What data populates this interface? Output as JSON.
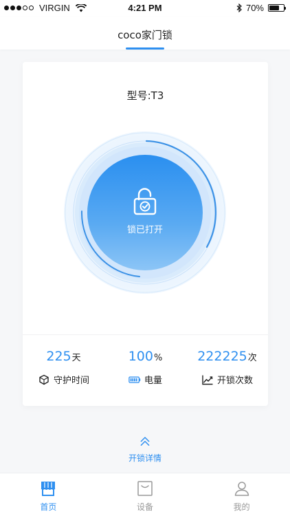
{
  "status_bar": {
    "carrier": "VIRGIN",
    "time": "4:21 PM",
    "battery": "70%",
    "battery_level": 0.7
  },
  "header": {
    "title": "coco家门锁"
  },
  "device": {
    "model": "型号:T3",
    "lock_status": "锁已打开",
    "lock_icon": "unlocked-padlock-icon"
  },
  "stats": [
    {
      "value": "225",
      "unit": "天",
      "label": "守护时间",
      "icon": "shield-icon"
    },
    {
      "value": "100",
      "unit": "%",
      "label": "电量",
      "icon": "battery-icon"
    },
    {
      "value": "222225",
      "unit": "次",
      "label": "开锁次数",
      "icon": "trend-chart-icon"
    }
  ],
  "detail": {
    "label": "开锁详情",
    "icon": "double-chevron-up-icon"
  },
  "tabs": [
    {
      "label": "首页",
      "icon": "home-icon",
      "active": true
    },
    {
      "label": "设备",
      "icon": "device-icon",
      "active": false
    },
    {
      "label": "我的",
      "icon": "user-icon",
      "active": false
    }
  ],
  "colors": {
    "accent": "#2e8ff0",
    "inactive": "#999999"
  }
}
